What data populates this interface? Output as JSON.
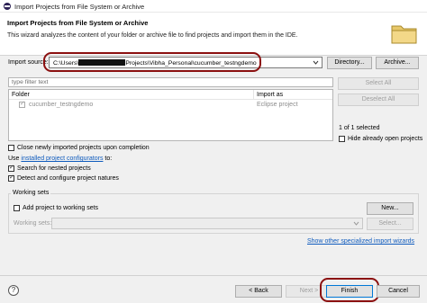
{
  "window": {
    "title": "Import Projects from File System or Archive"
  },
  "header": {
    "title": "Import Projects from File System or Archive",
    "description": "This wizard analyzes the content of your folder or archive file to find projects and import them in the IDE."
  },
  "source": {
    "label": "Import source:",
    "value_prefix": "C:\\Users\\",
    "value_suffix": "Projects\\Vibha_Personal\\cucumber_testngdemo",
    "directory_button": "Directory...",
    "archive_button": "Archive..."
  },
  "filter": {
    "placeholder": "type filter text"
  },
  "table": {
    "columns": [
      "Folder",
      "Import as"
    ],
    "rows": [
      {
        "folder": "cucumber_testngdemo",
        "import_as": "Eclipse project",
        "checked": true
      }
    ]
  },
  "side_buttons": {
    "select_all": "Select All",
    "deselect_all": "Deselect All"
  },
  "selection_count": "1 of 1 selected",
  "hide_open": {
    "label": "Hide already open projects",
    "checked": false
  },
  "options": {
    "close_projects": {
      "label": "Close newly imported projects upon completion",
      "checked": false
    },
    "use_prefix": "Use",
    "configurators_link": "installed project configurators",
    "use_suffix": "to:",
    "search_nested": {
      "label": "Search for nested projects",
      "checked": true
    },
    "detect_natures": {
      "label": "Detect and configure project natures",
      "checked": true
    }
  },
  "working_sets": {
    "title": "Working sets",
    "add_label": "Add project to working sets",
    "add_checked": false,
    "new_button": "New...",
    "label": "Working sets:",
    "select_button": "Select..."
  },
  "show_other_link": "Show other specialized import wizards",
  "footer": {
    "help_glyph": "?",
    "back": "< Back",
    "next": "Next >",
    "finish": "Finish",
    "cancel": "Cancel"
  },
  "colors": {
    "highlight_ring": "#8b1010",
    "link": "#0f5bbd"
  }
}
